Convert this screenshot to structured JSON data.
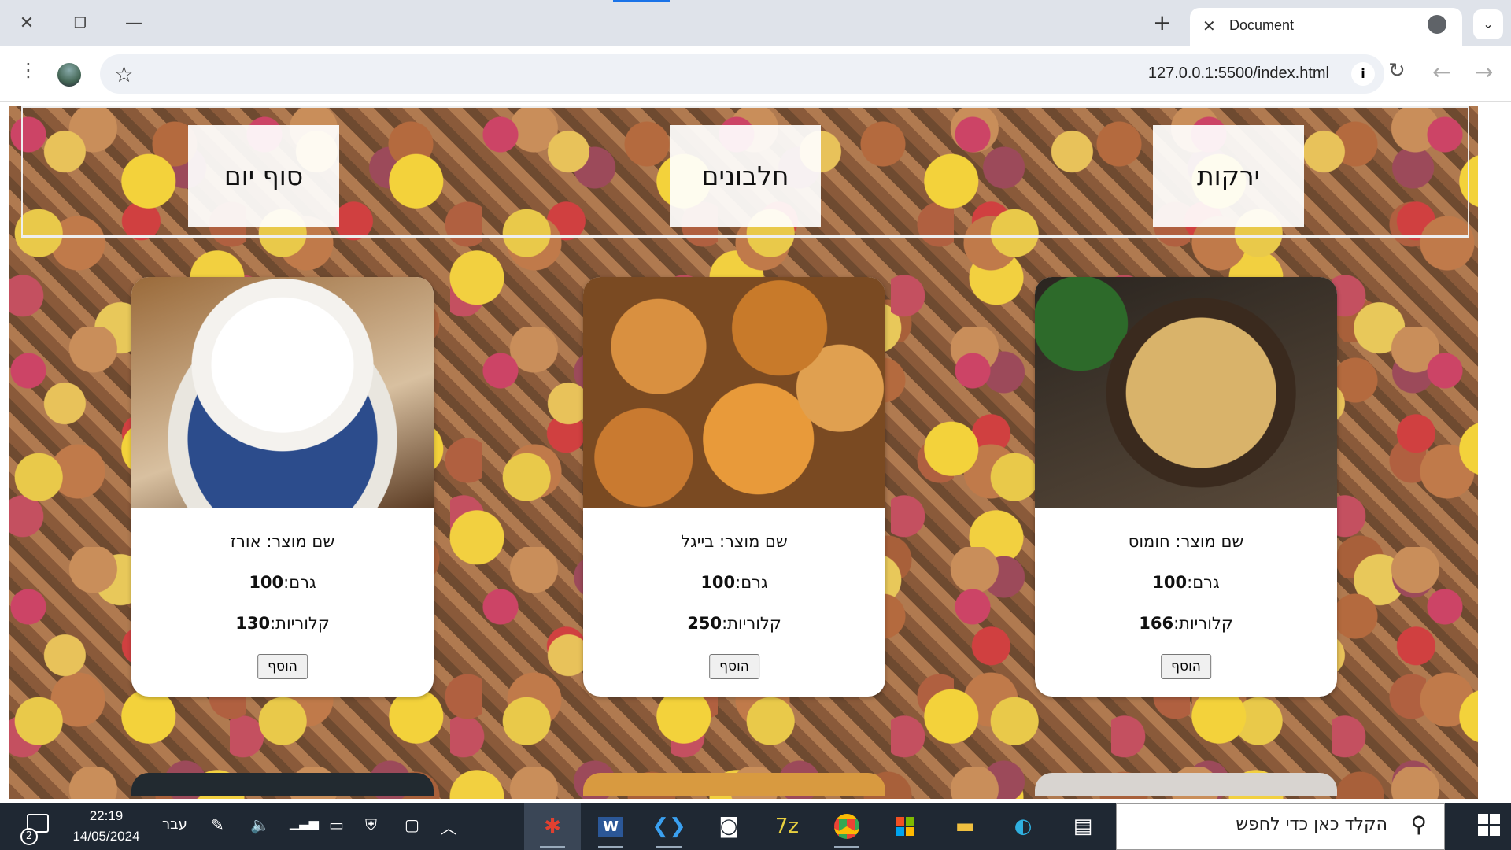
{
  "browser": {
    "tab_title": "Document",
    "tab_close": "✕",
    "new_tab": "+",
    "tab_menu": "⌄",
    "url": "127.0.0.1:5500/index.html",
    "info": "i"
  },
  "nav": {
    "items": [
      {
        "label": "ירקות"
      },
      {
        "label": "חלבונים"
      },
      {
        "label": "סוף יום"
      }
    ]
  },
  "products": [
    {
      "name": "שם מוצר: חומוס",
      "grams_label": "גרם:",
      "grams": "100",
      "cal_label": "קלוריות:",
      "calories": "166",
      "add": "הוסף"
    },
    {
      "name": "שם מוצר: בייגל",
      "grams_label": "גרם:",
      "grams": "100",
      "cal_label": "קלוריות:",
      "calories": "250",
      "add": "הוסף"
    },
    {
      "name": "שם מוצר: אורז",
      "grams_label": "גרם:",
      "grams": "100",
      "cal_label": "קלוריות:",
      "calories": "130",
      "add": "הוסף"
    }
  ],
  "taskbar": {
    "search_placeholder": "הקלד כאן כדי לחפש",
    "time": "22:19",
    "date": "14/05/2024",
    "lang": "עבר",
    "notif_count": "2"
  }
}
